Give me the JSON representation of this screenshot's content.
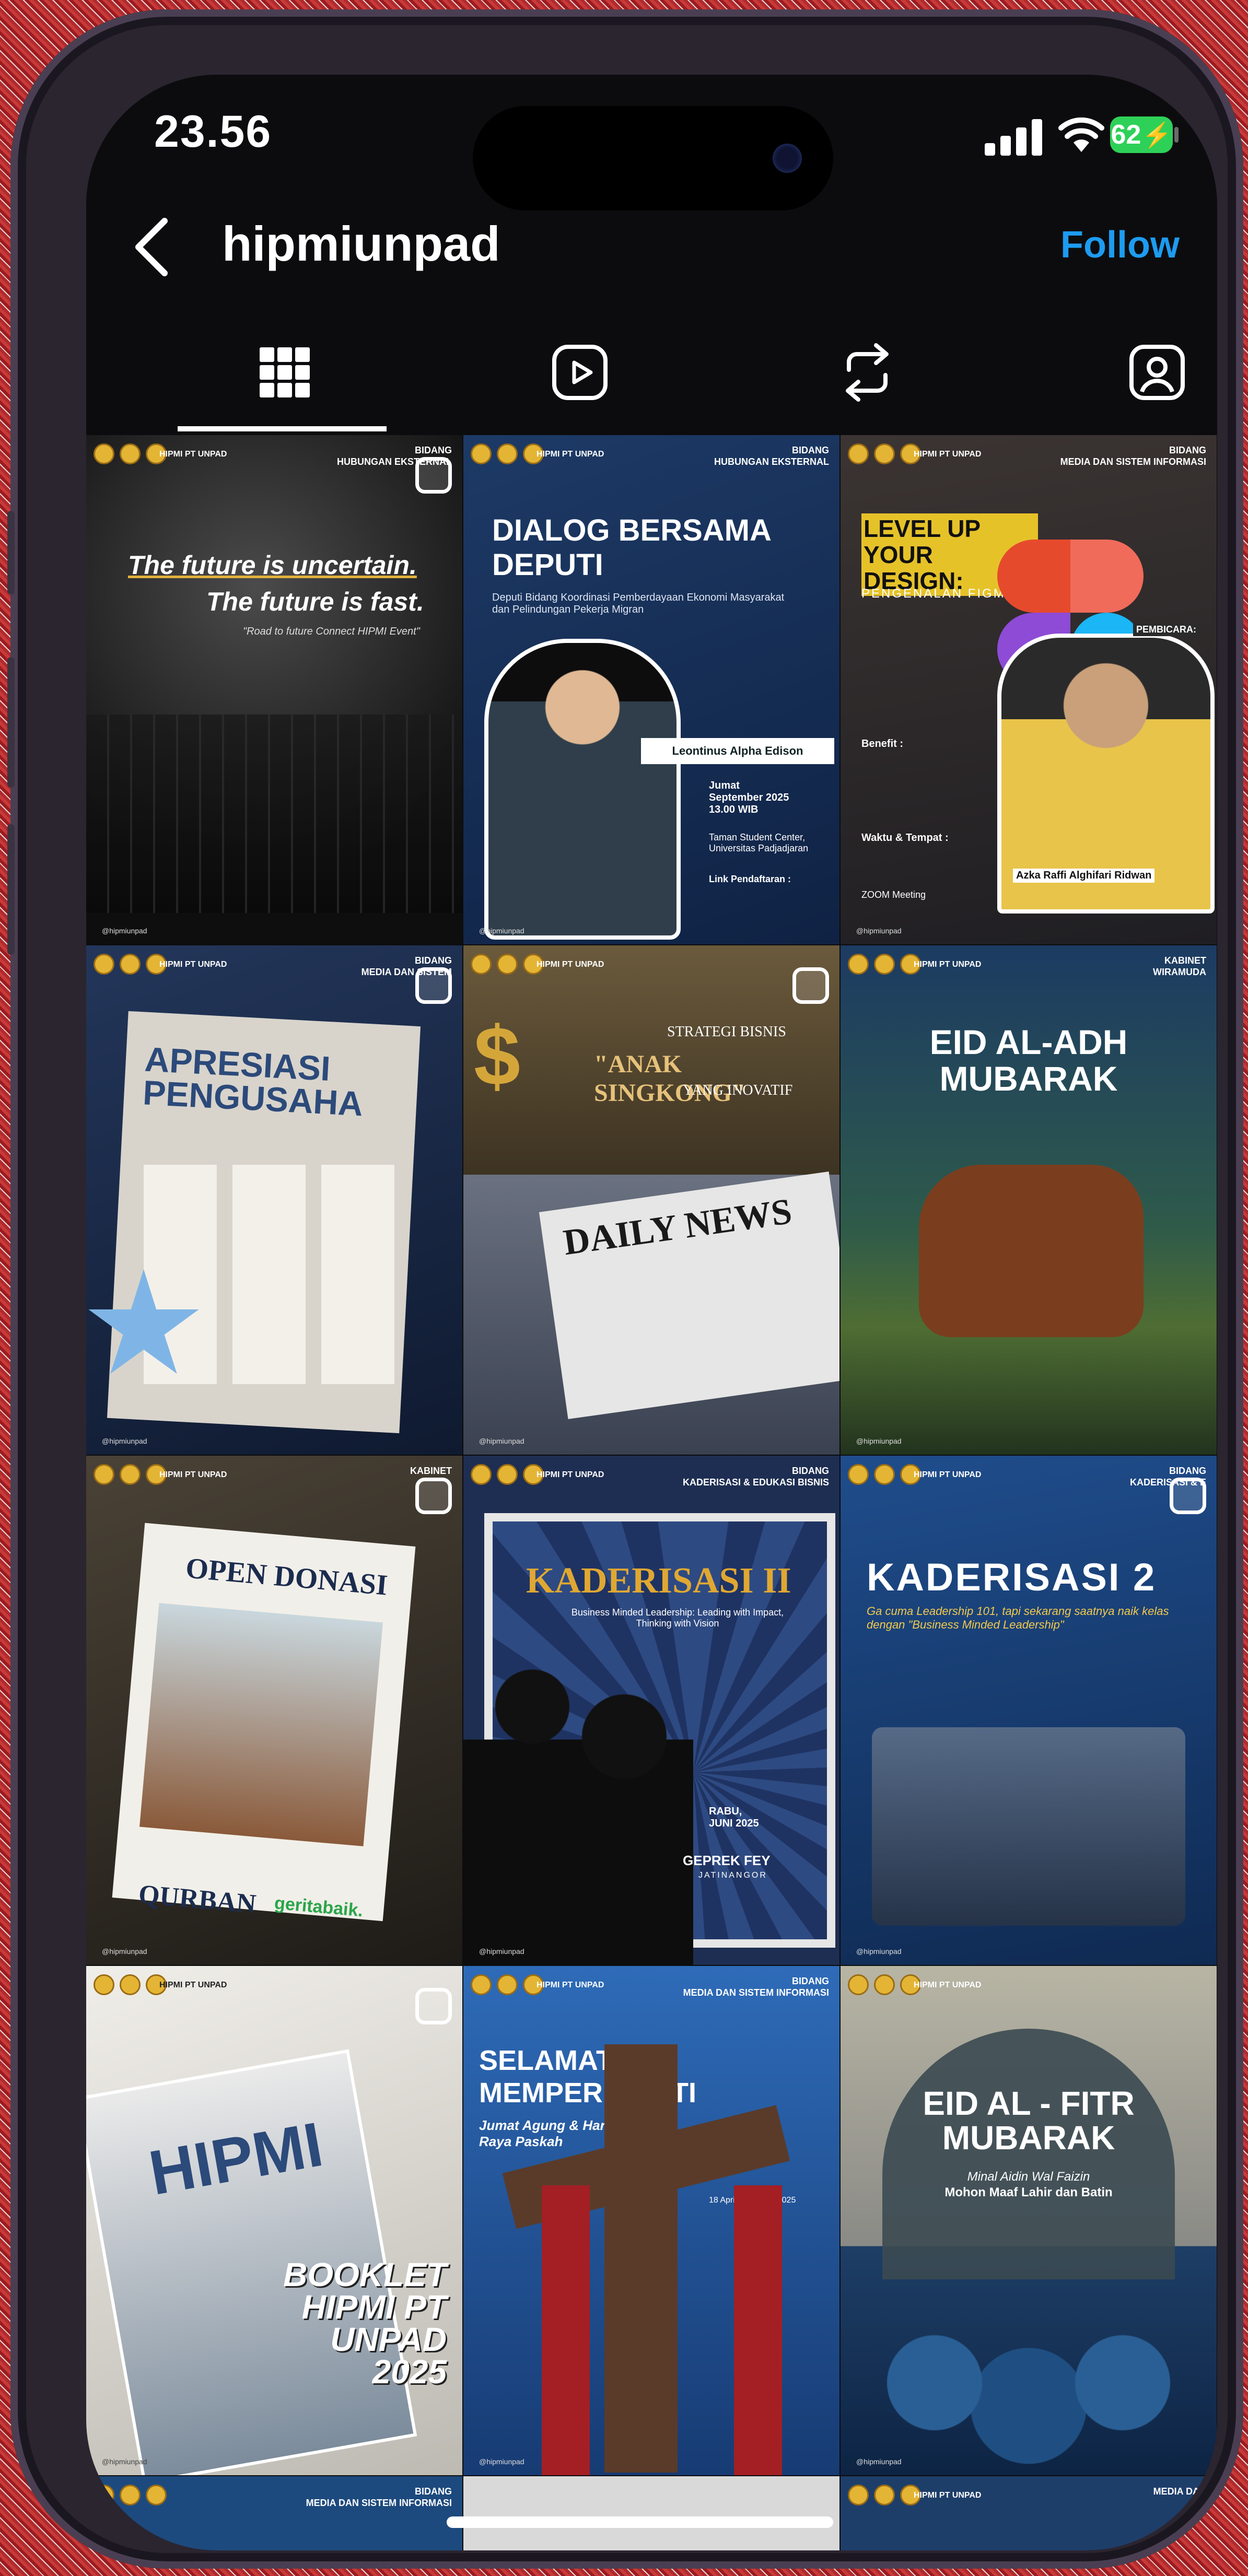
{
  "status_bar": {
    "time": "23.56",
    "battery": "62"
  },
  "header": {
    "username": "hipmiunpad",
    "follow_label": "Follow"
  },
  "tabs": [
    "grid-tab",
    "reels-tab",
    "reposts-tab",
    "tagged-tab"
  ],
  "colors": {
    "accent": "#1d9bf0",
    "background": "#0c0c0e",
    "battery": "#2ed158"
  },
  "posts": [
    {
      "division": "BIDANG\nHUBUNGAN EKSTERNAL",
      "line1": "The future is uncertain.",
      "line2": "The future is fast.",
      "sub": "\"Road to future Connect HIPMI Event\""
    },
    {
      "division": "BIDANG\nHUBUNGAN EKSTERNAL",
      "title": "DIALOG BERSAMA DEPUTI",
      "sub": "Deputi Bidang Koordinasi Pemberdayaan Ekonomi Masyarakat dan Pelindungan Pekerja Migran",
      "speaker": "Leontinus Alpha Edison",
      "date": "Jumat\nSeptember 2025\n13.00 WIB",
      "place": "Taman Student Center, Universitas Padjadjaran",
      "link": "Link Pendaftaran :"
    },
    {
      "division": "BIDANG\nMEDIA DAN SISTEM INFORMASI",
      "title": "LEVEL UP YOUR DESIGN:",
      "sub": "PENGENALAN FIGMA",
      "speaker": "Azka Raffi Alghifari Ridwan",
      "badge": "PEMBICARA:",
      "benefit": "Benefit :",
      "when": "Waktu & Tempat :",
      "zoom": "ZOOM Meeting"
    },
    {
      "division": "BIDANG\nMEDIA DAN SISTEM",
      "title": "APRESIASI PENGUSAHA"
    },
    {
      "title_small": "STRATEGI BISNIS",
      "title": "\"ANAK SINGKONG\"",
      "title2": "YANG INOVATIF",
      "news": "DAILY NEWS"
    },
    {
      "division": "KABINET\nWIRAMUDA",
      "title": "EID AL-ADH MUBARAK"
    },
    {
      "division": "KABINET",
      "title": "OPEN DONASI",
      "sub": "QURBAN",
      "brand": "geritabaik."
    },
    {
      "division": "BIDANG\nKADERISASI & EDUKASI BISNIS",
      "title": "KADERISASI II",
      "sub": "Business Minded Leadership: Leading with Impact, Thinking with Vision",
      "date": "RABU,\nJUNI 2025",
      "place": "GEPREK FEY",
      "place2": "JATINANGOR"
    },
    {
      "division": "BIDANG\nKADERISASI & E",
      "title": "KADERISASI 2",
      "sub": "Ga cuma Leadership 101, tapi sekarang saatnya naik kelas dengan \"Business Minded Leadership\""
    },
    {
      "title": "HIPMI",
      "sub": "BOOKLET HIPMI PT UNPAD 2025"
    },
    {
      "division": "BIDANG\nMEDIA DAN SISTEM INFORMASI",
      "title": "SELAMAT MEMPERINGATI",
      "sub": "Jumat Agung & Hari Raya Paskah",
      "date": "18 April & 20 April 2025"
    },
    {
      "title": "EID AL - FITR MUBARAK",
      "sub": "Minal Aidin Wal Faizin",
      "sub2": "Mohon Maaf Lahir dan Batin"
    }
  ],
  "next_row": [
    {
      "division": "BIDANG\nMEDIA DAN SISTEM INFORMASI"
    },
    {
      "division": ""
    },
    {
      "division": "MEDIA DAN"
    }
  ],
  "common": {
    "org": "HIPMI PT UNPAD",
    "handle": "@hipmiunpad"
  }
}
